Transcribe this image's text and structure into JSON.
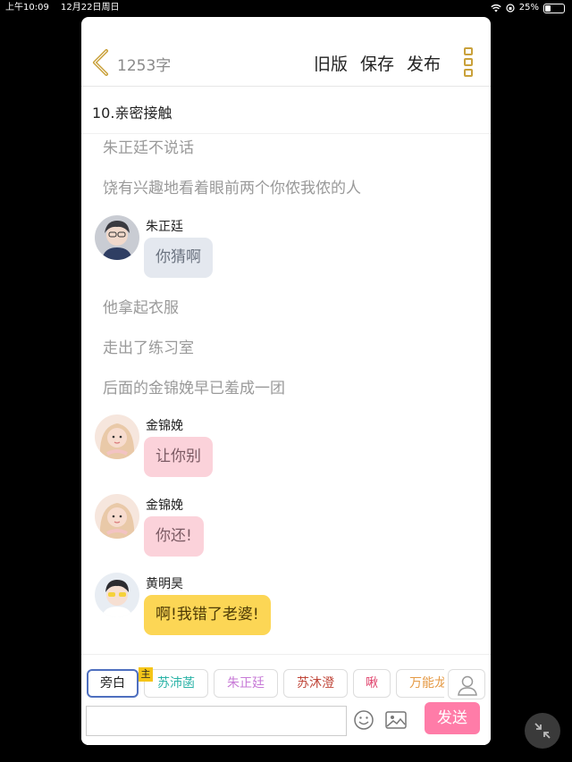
{
  "status_bar": {
    "time": "上午10:09",
    "date": "12月22日周日",
    "battery": "25%",
    "battery_level": 0.25
  },
  "header": {
    "word_count": "1253字",
    "actions": [
      "旧版",
      "保存",
      "发布"
    ]
  },
  "chapter": {
    "title": "10.亲密接触"
  },
  "story": [
    {
      "type": "narration",
      "text": "朱正廷不说话"
    },
    {
      "type": "narration",
      "text": "饶有兴趣地看着眼前两个你侬我侬的人"
    },
    {
      "type": "dialogue",
      "name": "朱正廷",
      "text": "你猜啊",
      "bubble": "gray"
    },
    {
      "type": "narration",
      "text": "他拿起衣服"
    },
    {
      "type": "narration",
      "text": "走出了练习室"
    },
    {
      "type": "narration",
      "text": "后面的金锦娩早已羞成一团"
    },
    {
      "type": "dialogue",
      "name": "金锦娩",
      "text": "让你别",
      "bubble": "pink"
    },
    {
      "type": "dialogue",
      "name": "金锦娩",
      "text": "你还!",
      "bubble": "pink"
    },
    {
      "type": "dialogue",
      "name": "黄明昊",
      "text": "啊!我错了老婆!",
      "bubble": "yellow"
    }
  ],
  "roles": [
    {
      "label": "旁白",
      "color": "#222222"
    },
    {
      "label": "苏沛菡",
      "color": "#2bb3a7"
    },
    {
      "label": "朱正廷",
      "color": "#c77ad6"
    },
    {
      "label": "苏沐澄",
      "color": "#c0473a"
    },
    {
      "label": "啾",
      "color": "#e0456e"
    },
    {
      "label": "万能龙",
      "color": "#e59a45"
    }
  ],
  "host_badge": "主",
  "input": {
    "value": "",
    "placeholder": ""
  },
  "send_label": "发送",
  "colors": {
    "accent": "#c9a13b",
    "send": "#ff7ca8"
  },
  "icons": [
    "back-icon",
    "more-icon",
    "user-icon",
    "emoji-icon",
    "image-icon",
    "collapse-icon"
  ]
}
